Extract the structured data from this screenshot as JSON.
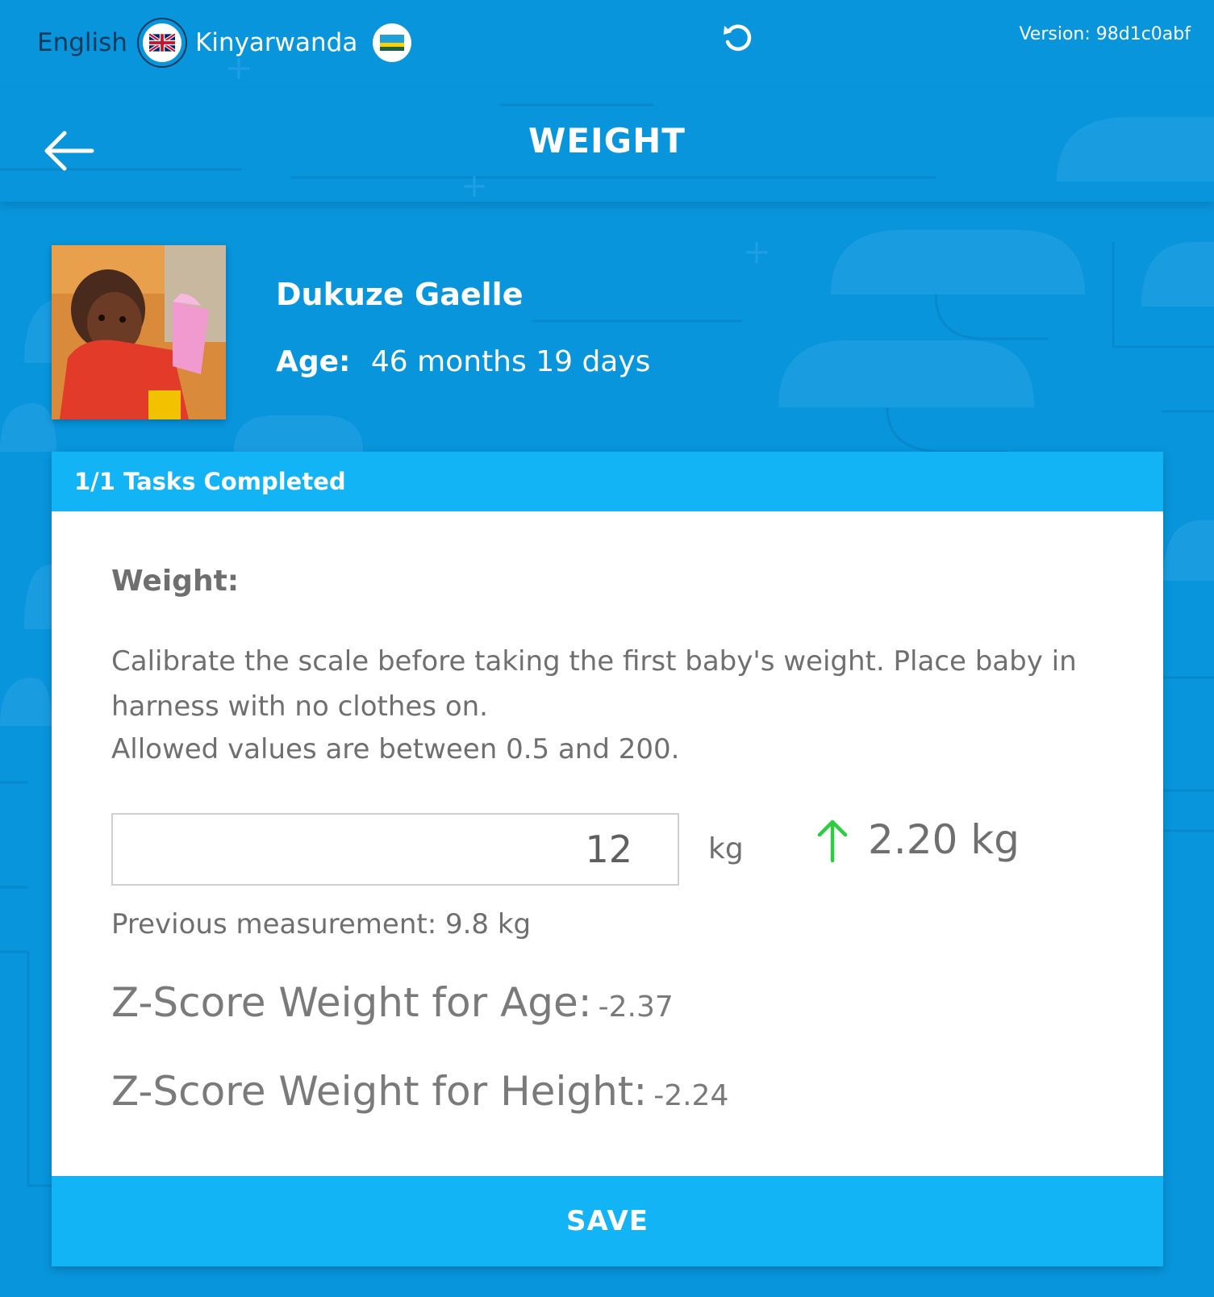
{
  "topbar": {
    "languages": [
      {
        "label": "English",
        "flag_icon": "uk-flag-icon",
        "active": true
      },
      {
        "label": "Kinyarwanda",
        "flag_icon": "rwanda-flag-icon",
        "active": false
      }
    ],
    "refresh_icon": "refresh-icon",
    "version": "Version: 98d1c0abf"
  },
  "header": {
    "back_icon": "back-arrow-icon",
    "title": "WEIGHT"
  },
  "patient": {
    "name": "Dukuze Gaelle",
    "age_label": "Age:",
    "age_value": "46 months 19 days"
  },
  "card": {
    "tasks_status": "1/1 Tasks Completed",
    "field_label": "Weight:",
    "instructions": "Calibrate the scale before taking the first baby's weight. Place baby in harness with no clothes on.",
    "allowed_values": "Allowed values are between 0.5 and 200.",
    "weight_value": "12",
    "unit": "kg",
    "change_icon": "arrow-up-icon",
    "change_value": "2.20 kg",
    "previous_measurement": "Previous measurement: 9.8 kg",
    "zscore_age_label": "Z-Score Weight for Age:",
    "zscore_age_value": "-2.37",
    "zscore_height_label": "Z-Score Weight for Height:",
    "zscore_height_value": "-2.24",
    "save_label": "SAVE"
  },
  "colors": {
    "background": "#0895dc",
    "accent": "#12b4f5",
    "increase_green": "#2ecc40"
  }
}
